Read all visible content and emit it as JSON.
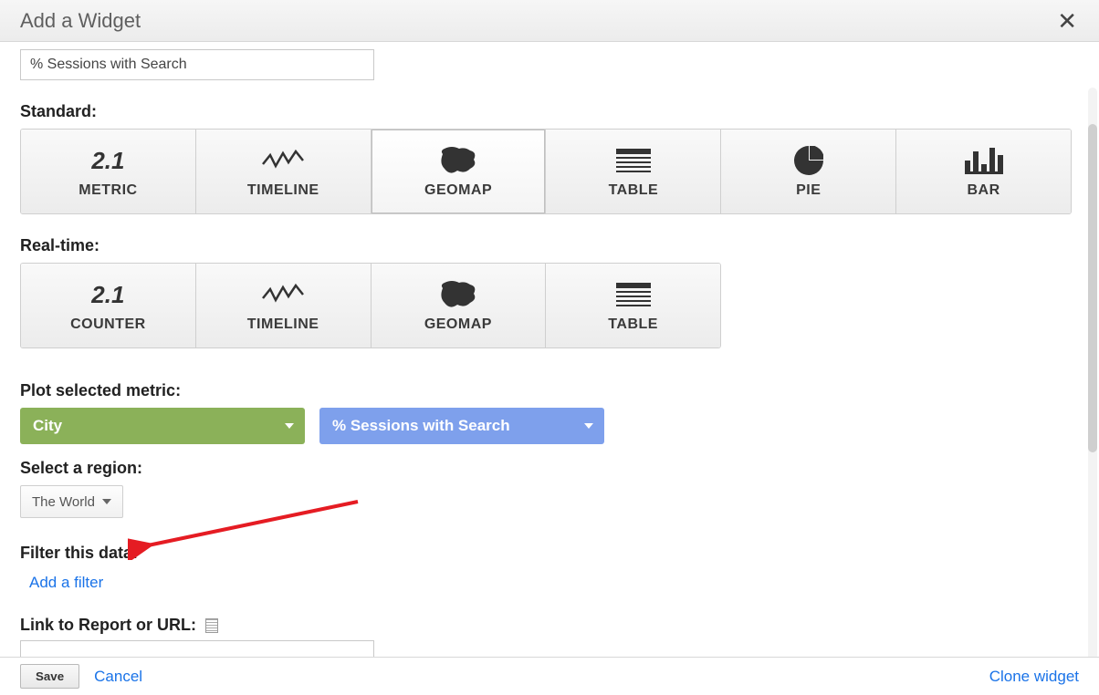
{
  "title": "Add a Widget",
  "name_input_value": "% Sessions with Search",
  "sections": {
    "standard_label": "Standard:",
    "realtime_label": "Real-time:",
    "plot_label": "Plot selected metric:",
    "region_label": "Select a region:",
    "filter_label": "Filter this data:",
    "link_label": "Link to Report or URL:"
  },
  "tiles_standard": [
    {
      "key": "metric",
      "label": "METRIC",
      "icon": "metric",
      "selected": false
    },
    {
      "key": "timeline",
      "label": "TIMELINE",
      "icon": "timeline",
      "selected": false
    },
    {
      "key": "geomap",
      "label": "GEOMAP",
      "icon": "geomap",
      "selected": true
    },
    {
      "key": "table",
      "label": "TABLE",
      "icon": "table",
      "selected": false
    },
    {
      "key": "pie",
      "label": "PIE",
      "icon": "pie",
      "selected": false
    },
    {
      "key": "bar",
      "label": "BAR",
      "icon": "bar",
      "selected": false
    }
  ],
  "tiles_realtime": [
    {
      "key": "counter",
      "label": "COUNTER",
      "icon": "metric"
    },
    {
      "key": "timeline",
      "label": "TIMELINE",
      "icon": "timeline"
    },
    {
      "key": "geomap",
      "label": "GEOMAP",
      "icon": "geomap"
    },
    {
      "key": "table",
      "label": "TABLE",
      "icon": "table"
    }
  ],
  "metric_glyph": "2.1",
  "plot": {
    "dimension": "City",
    "metric": "% Sessions with Search"
  },
  "region_selected": "The World",
  "filter_link_text": "Add a filter",
  "url_value": "",
  "footer": {
    "save": "Save",
    "cancel": "Cancel",
    "clone": "Clone widget"
  }
}
